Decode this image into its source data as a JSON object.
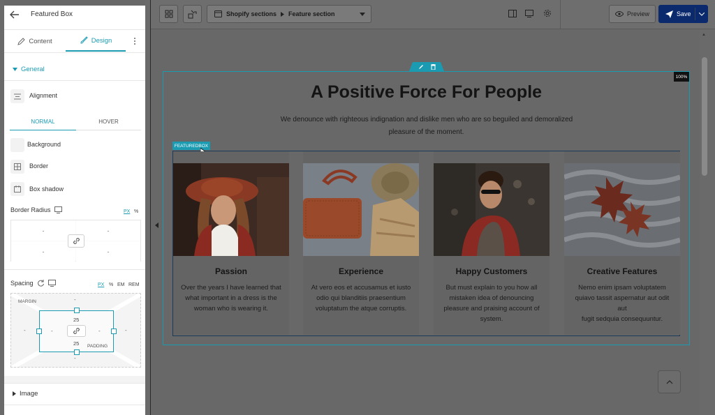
{
  "sidebar": {
    "title": "Featured Box",
    "tabs": [
      {
        "label": "Content"
      },
      {
        "label": "Design"
      }
    ],
    "general_label": "General",
    "alignment_label": "Alignment",
    "state_tabs": [
      {
        "label": "NORMAL"
      },
      {
        "label": "HOVER"
      }
    ],
    "background_label": "Background",
    "border_label": "Border",
    "box_shadow_label": "Box shadow",
    "border_radius_label": "Border Radius",
    "radius_units": [
      "PX",
      "%"
    ],
    "radius_values": [
      "-",
      "-",
      "-",
      "-"
    ],
    "spacing_label": "Spacing",
    "spacing_units": [
      "PX",
      "%",
      "EM",
      "REM"
    ],
    "margin_label": "MARGIN",
    "padding_label": "PADDING",
    "margin_values": {
      "top": "-",
      "right": "-",
      "bottom": "-",
      "left": "-"
    },
    "padding_values": {
      "top": "25",
      "right": "-",
      "bottom": "25",
      "left": "-"
    },
    "image_label": "Image"
  },
  "toolbar": {
    "breadcrumb_root": "Shopify sections",
    "breadcrumb_current": "Feature section",
    "preview_label": "Preview",
    "save_label": "Save"
  },
  "canvas": {
    "zoom_badge": "100%",
    "heading": "A Positive Force For People",
    "subtext_line1": "We denounce with righteous indignation and dislike men who are so beguiled and demoralized",
    "subtext_line2": "pleasure of the moment.",
    "selected_tag": "FEATUREDBOX",
    "cards": [
      {
        "title": "Passion",
        "lines": [
          "Over the years I have learned that",
          "what important in a dress is the",
          "woman who is wearing it."
        ]
      },
      {
        "title": "Experience",
        "lines": [
          "At vero eos et accusamus et iusto",
          "odio qui blanditiis praesentium",
          "voluptatum the atque corruptis."
        ]
      },
      {
        "title": "Happy Customers",
        "lines": [
          "But must explain to you how all",
          "mistaken idea of denouncing",
          "pleasure and praising account of",
          "system."
        ]
      },
      {
        "title": "Creative Features",
        "lines": [
          "Nemo enim ipsam voluptatem",
          "quiavo tassit aspernatur aut odit aut",
          "fugit sedquia consequuntur."
        ]
      }
    ]
  },
  "colors": {
    "accent": "#1a9bb2",
    "save_bg": "#0b2a6e",
    "heading": "#141414"
  }
}
